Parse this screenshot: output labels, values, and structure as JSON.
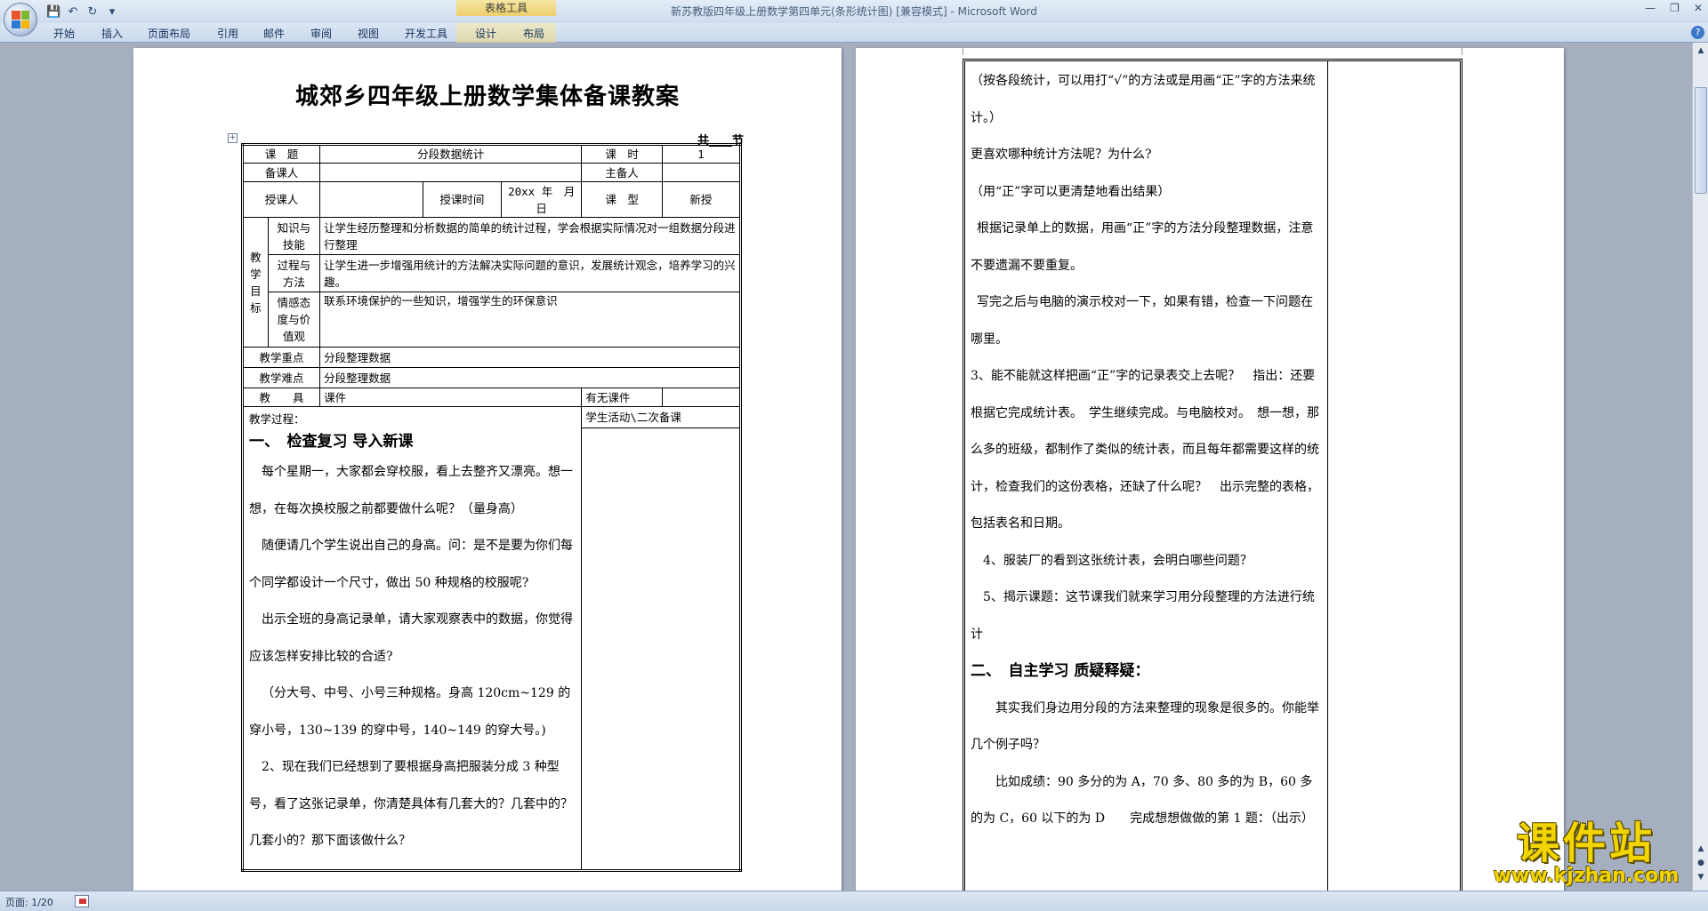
{
  "window": {
    "title": "新苏教版四年级上册数学第四单元(条形统计图) [兼容模式] - Microsoft Word",
    "context_tab_title": "表格工具"
  },
  "ribbon": {
    "tabs": [
      "开始",
      "插入",
      "页面布局",
      "引用",
      "邮件",
      "审阅",
      "视图",
      "开发工具",
      "设计",
      "布局"
    ]
  },
  "statusbar": {
    "page": "页面: 1/20"
  },
  "left_page": {
    "title": "城郊乡四年级上册数学集体备课教案",
    "period_label": "共____节",
    "table": {
      "topic_label": "课　题",
      "topic_value": "分段数据统计",
      "hours_label": "课　时",
      "hours_value": "1",
      "preparer_label": "备课人",
      "lead_label": "主备人",
      "teacher_label": "授课人",
      "time_label": "授课时间",
      "date_value": "20xx 年　月　日",
      "type_label": "课　型",
      "type_value": "新授",
      "goals_label": "教学目标",
      "goal1_label": "知识与技能",
      "goal1_text": "让学生经历整理和分析数据的简单的统计过程，学会根据实际情况对一组数据分段进行整理",
      "goal2_label": "过程与方法",
      "goal2_text": "让学生进一步增强用统计的方法解决实际问题的意识，发展统计观念，培养学习的兴趣。",
      "goal3_label": "情感态度与价值观",
      "goal3_text": "联系环境保护的一些知识，增强学生的环保意识",
      "key_label": "教学重点",
      "key_value": "分段整理数据",
      "difficulty_label": "教学难点",
      "difficulty_value": "分段整理数据",
      "tools_label": "教　　具",
      "tools_value": "课件",
      "courseware_label": "有无课件",
      "process_label": "教学过程：",
      "activity_label": "学生活动\\二次备课",
      "section1": "一、　检查复习 导入新课",
      "paragraphs": [
        "每个星期一，大家都会穿校服，看上去整齐又漂亮。想一想，在每次换校服之前都要做什么呢？（量身高）",
        "随便请几个学生说出自己的身高。问：是不是要为你们每个同学都设计一个尺寸，做出 50 种规格的校服呢?",
        "出示全班的身高记录单，请大家观察表中的数据，你觉得应该怎样安排比较的合适?",
        "（分大号、中号、小号三种规格。身高 120cm~129 的穿小号，130~139 的穿中号，140~149 的穿大号。)",
        "2、现在我们已经想到了要根据身高把服装分成 3 种型号，看了这张记录单，你清楚具体有几套大的？几套中的？几套小的？那下面该做什么？"
      ]
    }
  },
  "right_page": {
    "paragraphs": [
      "（按各段统计，可以用打“√”的方法或是用画“正”字的方法来统计。）",
      "更喜欢哪种统计方法呢？为什么?",
      "（用“正”字可以更清楚地看出结果）",
      "根据记录单上的数据，用画“正”字的方法分段整理数据，注意不要遗漏不要重复。",
      "写完之后与电脑的演示校对一下，如果有错，检查一下问题在哪里。",
      "3、能不能就这样把画“正”字的记录表交上去呢？　指出：还要根据它完成统计表。　学生继续完成。与电脑校对。　想一想，那么多的班级，都制作了类似的统计表，而且每年都需要这样的统计，检查我们的这份表格，还缺了什么呢？　出示完整的表格，包括表名和日期。",
      "4、服装厂的看到这张统计表，会明白哪些问题？",
      "5、揭示课题：这节课我们就来学习用分段整理的方法进行统计"
    ],
    "section2": "二、　自主学习 质疑释疑：",
    "paragraphs2": [
      "其实我们身边用分段的方法来整理的现象是很多的。你能举几个例子吗？",
      "比如成绩：90 多分的为 A，70 多、80 多的为 B，60 多的为 C，60 以下的为 D　　完成想想做做的第 1 题：（出示）"
    ]
  },
  "watermark": {
    "big": "课件站",
    "small": "www.kjzhan.com"
  }
}
